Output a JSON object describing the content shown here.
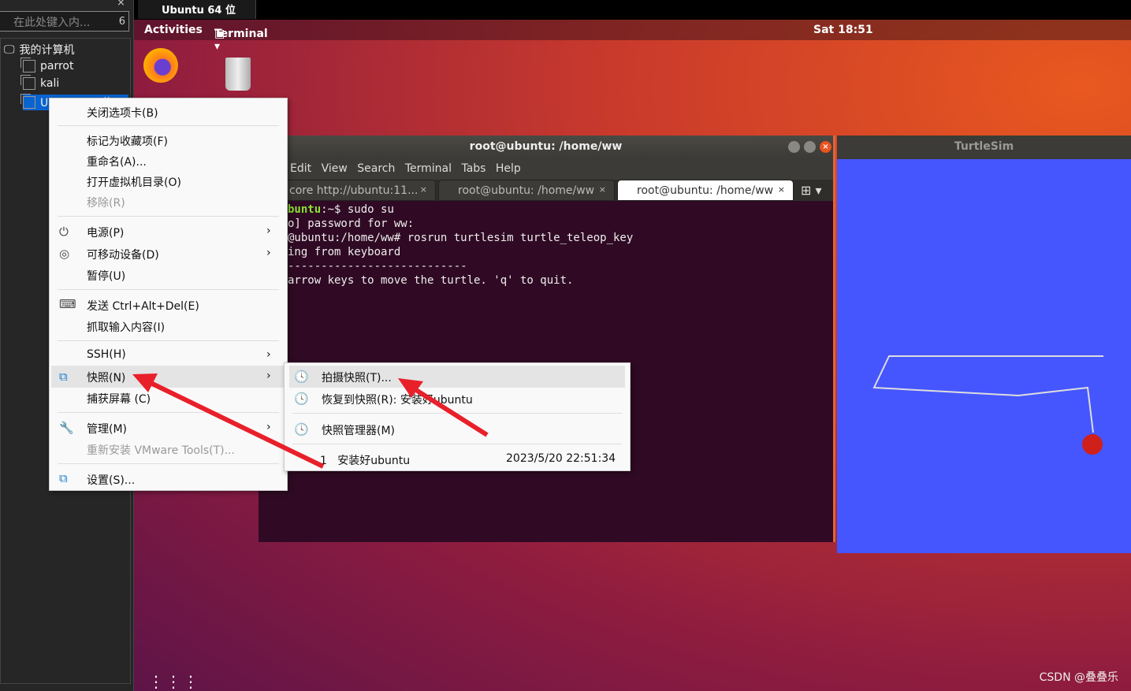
{
  "library": {
    "search_placeholder": "在此处键入内...",
    "search_count": "6",
    "root": "我的计算机",
    "vms": [
      "parrot",
      "kali",
      "Ubuntu 64 位"
    ]
  },
  "vm_tab": {
    "title": "Ubuntu 64 位"
  },
  "ubuntu": {
    "activities": "Activities",
    "app_menu": "Terminal ▾",
    "clock": "Sat 18:51"
  },
  "terminal": {
    "title": "root@ubuntu: /home/ww",
    "menu": [
      "Edit",
      "View",
      "Search",
      "Terminal",
      "Tabs",
      "Help"
    ],
    "tabs": [
      "core http://ubuntu:11...",
      "root@ubuntu: /home/ww",
      "root@ubuntu: /home/ww"
    ],
    "lines": [
      "buntu:~$ sudo su",
      "o] password for ww:",
      "@ubuntu:/home/ww# rosrun turtlesim turtle_teleop_key",
      "ing from keyboard",
      "---------------------------",
      "arrow keys to move the turtle. 'q' to quit."
    ]
  },
  "turtlesim": {
    "title": "TurtleSim",
    "background": "#4556ff"
  },
  "context_menu": {
    "items": [
      "关闭选项卡(B)",
      "标记为收藏项(F)",
      "重命名(A)...",
      "打开虚拟机目录(O)",
      "移除(R)",
      "电源(P)",
      "可移动设备(D)",
      "暂停(U)",
      "发送 Ctrl+Alt+Del(E)",
      "抓取输入内容(I)",
      "SSH(H)",
      "快照(N)",
      "捕获屏幕 (C)",
      "管理(M)",
      "重新安装 VMware Tools(T)...",
      "设置(S)..."
    ]
  },
  "snapshot_menu": {
    "take": "拍摄快照(T)...",
    "revert": "恢复到快照(R): 安装好ubuntu",
    "manager": "快照管理器(M)",
    "snapshot_index": "1",
    "snapshot_name": "安装好ubuntu",
    "snapshot_time": "2023/5/20 22:51:34"
  },
  "watermark": "CSDN @叠叠乐"
}
